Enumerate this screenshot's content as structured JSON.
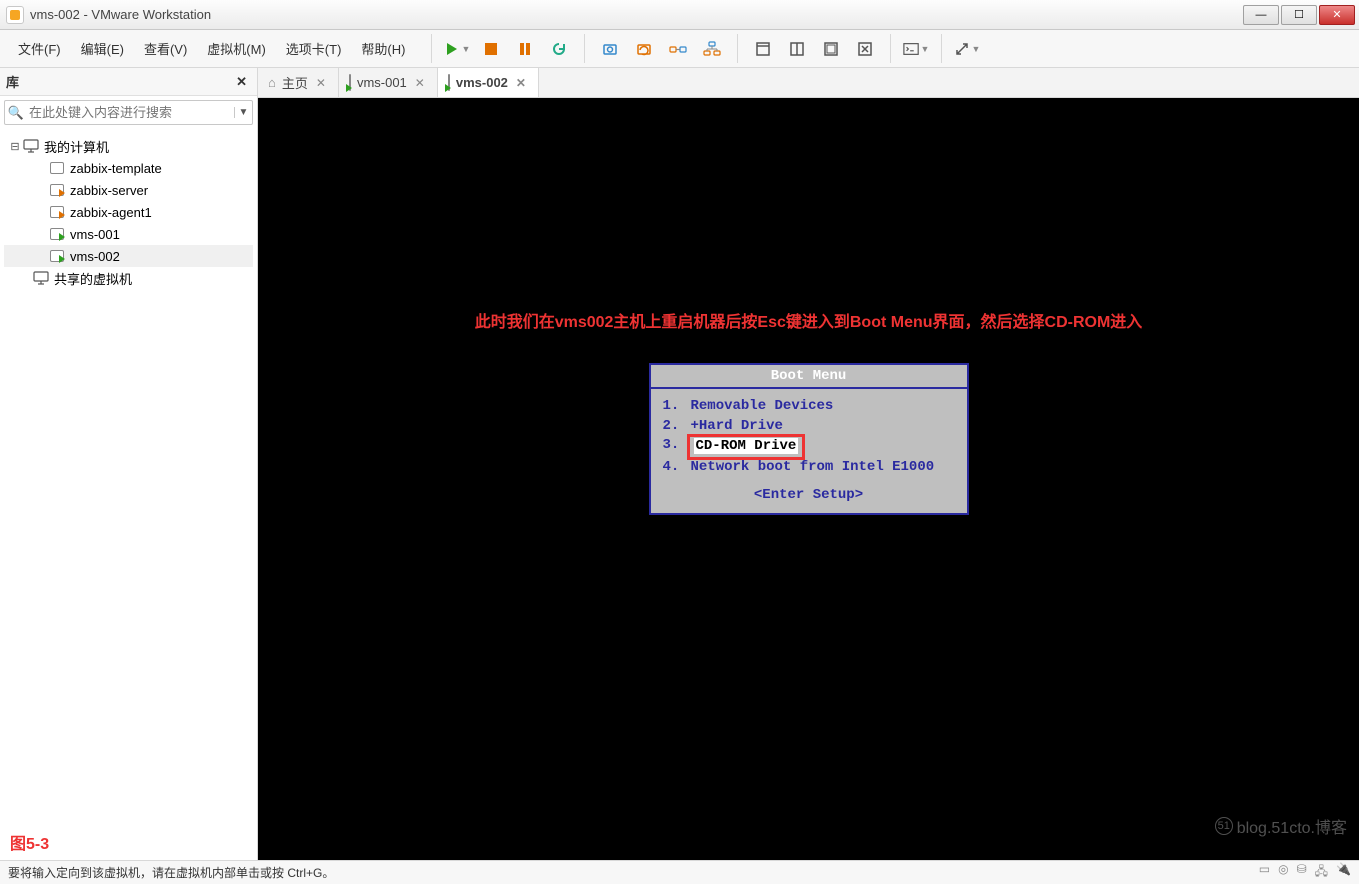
{
  "titlebar": {
    "title": "vms-002 - VMware Workstation"
  },
  "menus": [
    "文件(F)",
    "编辑(E)",
    "查看(V)",
    "虚拟机(M)",
    "选项卡(T)",
    "帮助(H)"
  ],
  "sidebar": {
    "header": "库",
    "search_placeholder": "在此处键入内容进行搜索",
    "tree": {
      "root": "我的计算机",
      "items": [
        {
          "label": "zabbix-template",
          "state": "plain"
        },
        {
          "label": "zabbix-server",
          "state": "runorange"
        },
        {
          "label": "zabbix-agent1",
          "state": "runorange"
        },
        {
          "label": "vms-001",
          "state": "run"
        },
        {
          "label": "vms-002",
          "state": "run",
          "selected": true
        }
      ],
      "shared": "共享的虚拟机"
    }
  },
  "tabs": [
    {
      "label": "主页",
      "type": "home"
    },
    {
      "label": "vms-001",
      "type": "vm-run"
    },
    {
      "label": "vms-002",
      "type": "vm-run",
      "active": true
    }
  ],
  "vm": {
    "annotation": "此时我们在vms002主机上重启机器后按Esc键进入到Boot Menu界面，然后选择CD-ROM进入",
    "bootmenu": {
      "title": "Boot Menu",
      "items": [
        {
          "num": "1.",
          "label": "Removable Devices"
        },
        {
          "num": "2.",
          "label": "+Hard Drive"
        },
        {
          "num": "3.",
          "label": "CD-ROM Drive",
          "selected": true
        },
        {
          "num": "4.",
          "label": "Network boot from Intel E1000"
        }
      ],
      "setup": "<Enter Setup>"
    },
    "figure_label": "图5-3"
  },
  "statusbar": {
    "message": "要将输入定向到该虚拟机，请在虚拟机内部单击或按 Ctrl+G。"
  },
  "watermark": "blog.51cto.博客"
}
